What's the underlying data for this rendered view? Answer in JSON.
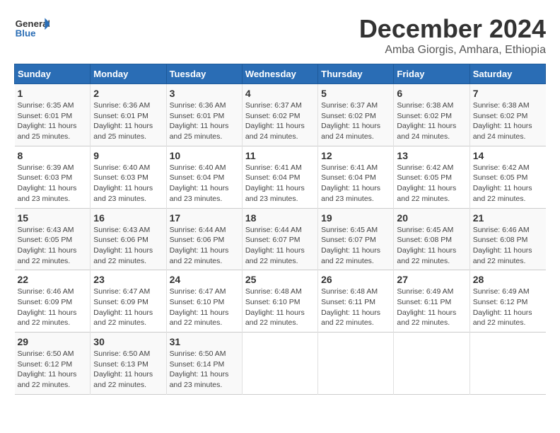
{
  "logo": {
    "text_general": "General",
    "text_blue": "Blue"
  },
  "title": "December 2024",
  "subtitle": "Amba Giorgis, Amhara, Ethiopia",
  "headers": [
    "Sunday",
    "Monday",
    "Tuesday",
    "Wednesday",
    "Thursday",
    "Friday",
    "Saturday"
  ],
  "weeks": [
    [
      {
        "day": "1",
        "info": "Sunrise: 6:35 AM\nSunset: 6:01 PM\nDaylight: 11 hours\nand 25 minutes."
      },
      {
        "day": "2",
        "info": "Sunrise: 6:36 AM\nSunset: 6:01 PM\nDaylight: 11 hours\nand 25 minutes."
      },
      {
        "day": "3",
        "info": "Sunrise: 6:36 AM\nSunset: 6:01 PM\nDaylight: 11 hours\nand 25 minutes."
      },
      {
        "day": "4",
        "info": "Sunrise: 6:37 AM\nSunset: 6:02 PM\nDaylight: 11 hours\nand 24 minutes."
      },
      {
        "day": "5",
        "info": "Sunrise: 6:37 AM\nSunset: 6:02 PM\nDaylight: 11 hours\nand 24 minutes."
      },
      {
        "day": "6",
        "info": "Sunrise: 6:38 AM\nSunset: 6:02 PM\nDaylight: 11 hours\nand 24 minutes."
      },
      {
        "day": "7",
        "info": "Sunrise: 6:38 AM\nSunset: 6:02 PM\nDaylight: 11 hours\nand 24 minutes."
      }
    ],
    [
      {
        "day": "8",
        "info": "Sunrise: 6:39 AM\nSunset: 6:03 PM\nDaylight: 11 hours\nand 23 minutes."
      },
      {
        "day": "9",
        "info": "Sunrise: 6:40 AM\nSunset: 6:03 PM\nDaylight: 11 hours\nand 23 minutes."
      },
      {
        "day": "10",
        "info": "Sunrise: 6:40 AM\nSunset: 6:04 PM\nDaylight: 11 hours\nand 23 minutes."
      },
      {
        "day": "11",
        "info": "Sunrise: 6:41 AM\nSunset: 6:04 PM\nDaylight: 11 hours\nand 23 minutes."
      },
      {
        "day": "12",
        "info": "Sunrise: 6:41 AM\nSunset: 6:04 PM\nDaylight: 11 hours\nand 23 minutes."
      },
      {
        "day": "13",
        "info": "Sunrise: 6:42 AM\nSunset: 6:05 PM\nDaylight: 11 hours\nand 22 minutes."
      },
      {
        "day": "14",
        "info": "Sunrise: 6:42 AM\nSunset: 6:05 PM\nDaylight: 11 hours\nand 22 minutes."
      }
    ],
    [
      {
        "day": "15",
        "info": "Sunrise: 6:43 AM\nSunset: 6:05 PM\nDaylight: 11 hours\nand 22 minutes."
      },
      {
        "day": "16",
        "info": "Sunrise: 6:43 AM\nSunset: 6:06 PM\nDaylight: 11 hours\nand 22 minutes."
      },
      {
        "day": "17",
        "info": "Sunrise: 6:44 AM\nSunset: 6:06 PM\nDaylight: 11 hours\nand 22 minutes."
      },
      {
        "day": "18",
        "info": "Sunrise: 6:44 AM\nSunset: 6:07 PM\nDaylight: 11 hours\nand 22 minutes."
      },
      {
        "day": "19",
        "info": "Sunrise: 6:45 AM\nSunset: 6:07 PM\nDaylight: 11 hours\nand 22 minutes."
      },
      {
        "day": "20",
        "info": "Sunrise: 6:45 AM\nSunset: 6:08 PM\nDaylight: 11 hours\nand 22 minutes."
      },
      {
        "day": "21",
        "info": "Sunrise: 6:46 AM\nSunset: 6:08 PM\nDaylight: 11 hours\nand 22 minutes."
      }
    ],
    [
      {
        "day": "22",
        "info": "Sunrise: 6:46 AM\nSunset: 6:09 PM\nDaylight: 11 hours\nand 22 minutes."
      },
      {
        "day": "23",
        "info": "Sunrise: 6:47 AM\nSunset: 6:09 PM\nDaylight: 11 hours\nand 22 minutes."
      },
      {
        "day": "24",
        "info": "Sunrise: 6:47 AM\nSunset: 6:10 PM\nDaylight: 11 hours\nand 22 minutes."
      },
      {
        "day": "25",
        "info": "Sunrise: 6:48 AM\nSunset: 6:10 PM\nDaylight: 11 hours\nand 22 minutes."
      },
      {
        "day": "26",
        "info": "Sunrise: 6:48 AM\nSunset: 6:11 PM\nDaylight: 11 hours\nand 22 minutes."
      },
      {
        "day": "27",
        "info": "Sunrise: 6:49 AM\nSunset: 6:11 PM\nDaylight: 11 hours\nand 22 minutes."
      },
      {
        "day": "28",
        "info": "Sunrise: 6:49 AM\nSunset: 6:12 PM\nDaylight: 11 hours\nand 22 minutes."
      }
    ],
    [
      {
        "day": "29",
        "info": "Sunrise: 6:50 AM\nSunset: 6:12 PM\nDaylight: 11 hours\nand 22 minutes."
      },
      {
        "day": "30",
        "info": "Sunrise: 6:50 AM\nSunset: 6:13 PM\nDaylight: 11 hours\nand 22 minutes."
      },
      {
        "day": "31",
        "info": "Sunrise: 6:50 AM\nSunset: 6:14 PM\nDaylight: 11 hours\nand 23 minutes."
      },
      {
        "day": "",
        "info": ""
      },
      {
        "day": "",
        "info": ""
      },
      {
        "day": "",
        "info": ""
      },
      {
        "day": "",
        "info": ""
      }
    ]
  ]
}
